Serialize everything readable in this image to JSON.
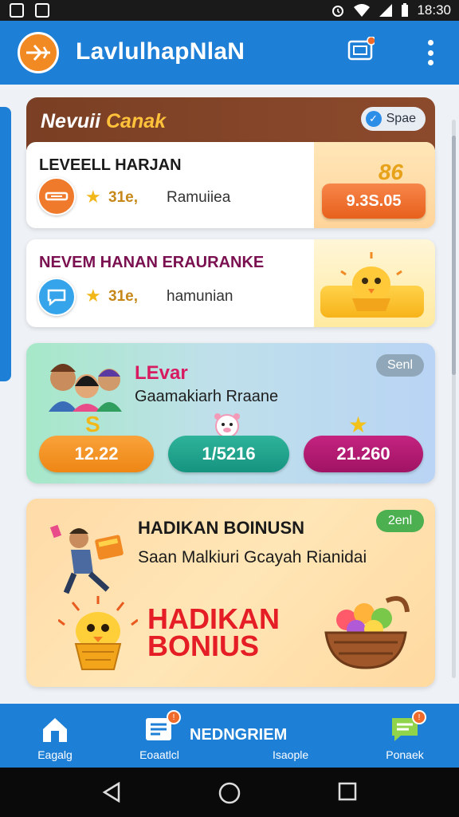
{
  "status_bar": {
    "time": "18:30"
  },
  "app_bar": {
    "title": "LavlulhapNlaN"
  },
  "section_card": {
    "title_main": "Nevuii",
    "title_accent": "Canak",
    "spec_label": "Spae"
  },
  "level_rows": [
    {
      "title": "LEVEELL HARJAN",
      "score": "31e,",
      "subtitle": "Ramuiiea",
      "reward_top": "86",
      "reward_value": "9.3S.05"
    },
    {
      "title": "NEVEM HANAN ERAURANKE",
      "score": "31e,",
      "subtitle": "hamunian"
    }
  ],
  "level_card": {
    "title": "LEvar",
    "subtitle": "Gaamakiarh Rraane",
    "pill": "Senl",
    "stats": [
      "12.22",
      "1/5216",
      "21.260"
    ]
  },
  "bonus_card": {
    "title": "HADIKAN BOINUSN",
    "subtitle": "Saan Malkiuri Gcayah Rianidai",
    "pill": "2enl",
    "big_line1": "HADIKAN",
    "big_line2": "BONIUS"
  },
  "bottom_nav": {
    "home_label": "Eagalg",
    "news_label": "Eoaatlcl",
    "center_title": "NEDNGRIEM",
    "center_sub": "Isaople",
    "msg_label": "Ponaek"
  },
  "colors": {
    "app_bar": "#1e7fd6",
    "card_header": "#7a3f24",
    "accent_orange": "#ee8614",
    "accent_teal": "#159480",
    "accent_magenta": "#a01364",
    "bonus_red": "#e51e25"
  },
  "icons": [
    "wifi-icon",
    "signal-icon",
    "battery-icon",
    "alarm-icon",
    "notification-icon",
    "overflow-menu-icon",
    "home-icon",
    "news-icon",
    "message-icon",
    "back-icon",
    "home-circle-icon",
    "recents-icon"
  ]
}
